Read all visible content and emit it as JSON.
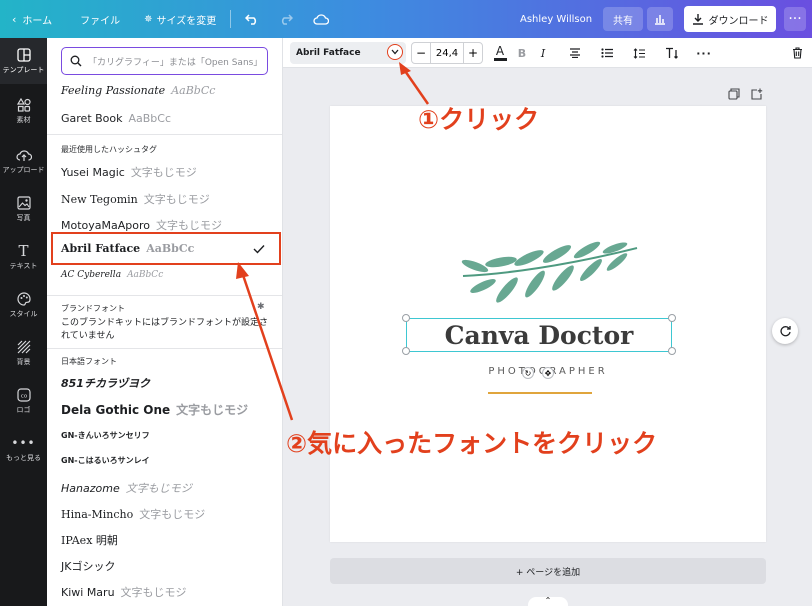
{
  "topbar": {
    "home": "ホーム",
    "file": "ファイル",
    "resize": "サイズを変更",
    "user": "Ashley Willson",
    "share": "共有",
    "download": "ダウンロード"
  },
  "leftnav": [
    {
      "label": "テンプレート",
      "icon": "template-icon"
    },
    {
      "label": "素材",
      "icon": "elements-icon"
    },
    {
      "label": "アップロード",
      "icon": "upload-icon"
    },
    {
      "label": "写真",
      "icon": "photo-icon"
    },
    {
      "label": "テキスト",
      "icon": "text-icon"
    },
    {
      "label": "スタイル",
      "icon": "palette-icon"
    },
    {
      "label": "背景",
      "icon": "background-icon"
    },
    {
      "label": "ロゴ",
      "icon": "logo-icon"
    },
    {
      "label": "もっと見る",
      "icon": "more-icon"
    }
  ],
  "panel": {
    "search_placeholder": "「カリグラフィー」または「Open Sans」",
    "top_fonts": [
      {
        "name": "Feeling Passionate",
        "sample": "AaBbCc"
      },
      {
        "name": "Garet Book",
        "sample": "AaBbCc"
      }
    ],
    "recent_heading": "最近使用したハッシュタグ",
    "recent_fonts": [
      {
        "name": "Yusei Magic",
        "sample": "文字もじモジ"
      },
      {
        "name": "New Tegomin",
        "sample": "文字もじモジ"
      },
      {
        "name": "MotoyaMaAporo",
        "sample": "文字もじモジ"
      },
      {
        "name": "Abril Fatface",
        "sample": "AaBbCc"
      },
      {
        "name": "AC Cyberella",
        "sample": "AaBbCc"
      }
    ],
    "brand_heading": "ブランドフォント",
    "brand_text": "このブランドキットにはブランドフォントが設定されていません",
    "jp_heading": "日本語フォント",
    "jp_fonts": [
      {
        "name": "851チカラヅヨク",
        "sample": ""
      },
      {
        "name": "Dela Gothic One",
        "sample": "文字もじモジ"
      },
      {
        "name": "GN-きんいろサンセリフ",
        "sample": ""
      },
      {
        "name": "GN-こはるいろサンレイ",
        "sample": ""
      },
      {
        "name": "Hanazome",
        "sample": "文字もじモジ"
      },
      {
        "name": "Hina-Mincho",
        "sample": "文字もじモジ"
      },
      {
        "name": "IPAex 明朝",
        "sample": ""
      },
      {
        "name": "JKゴシック",
        "sample": ""
      },
      {
        "name": "Kiwi Maru",
        "sample": "文字もじモジ"
      }
    ]
  },
  "toolbar": {
    "font": "Abril Fatface",
    "size": "24,4",
    "minus": "−",
    "plus": "+",
    "bold": "B",
    "italic": "I"
  },
  "canvas": {
    "title": "Canva Doctor",
    "subtitle": "PHOTOGRAPHER",
    "add_page": "+ ページを追加"
  },
  "annotations": {
    "step1": "①クリック",
    "step2": "②気に入ったフォントをクリック"
  },
  "colors": {
    "accent": "#e2401d",
    "selection": "#3ec7d2",
    "leaf": "#4e9a80",
    "gold": "#e0a53c"
  }
}
